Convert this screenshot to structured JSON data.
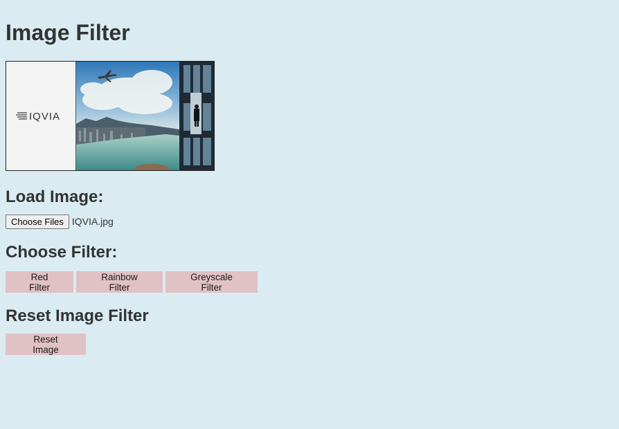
{
  "page": {
    "title": "Image Filter"
  },
  "image": {
    "logo_text": "IQVIA"
  },
  "load_section": {
    "heading": "Load Image:",
    "choose_files_label": "Choose Files",
    "file_name": "IQVIA.jpg"
  },
  "filter_section": {
    "heading": "Choose Filter:",
    "buttons": [
      {
        "label": "Red Filter"
      },
      {
        "label": "Rainbow Filter"
      },
      {
        "label": "Greyscale Filter"
      }
    ]
  },
  "reset_section": {
    "heading": "Reset Image Filter",
    "reset_label": "Reset Image"
  },
  "colors": {
    "background": "#daebf2",
    "button_bg": "#e0c1c4",
    "text": "#333333"
  }
}
